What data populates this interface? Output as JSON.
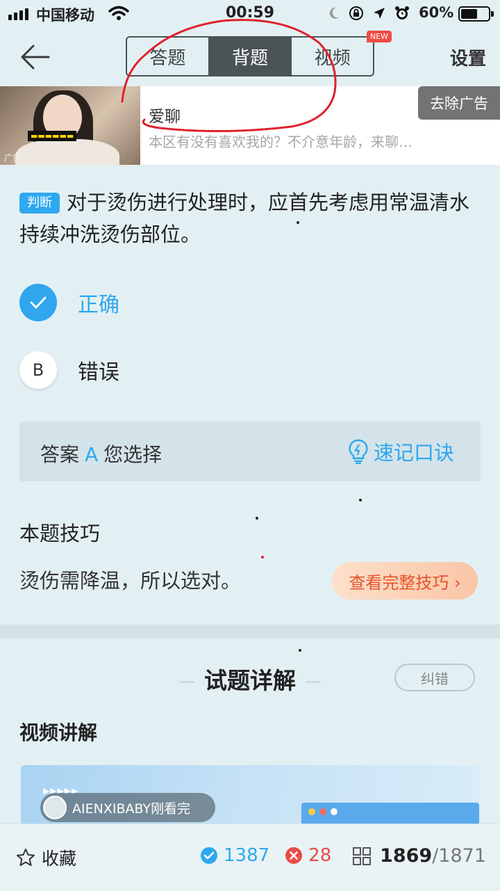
{
  "status_bar": {
    "carrier": "中国移动",
    "time": "00:59",
    "battery_pct": "60%",
    "battery_level": 0.6
  },
  "nav": {
    "tabs": [
      {
        "label": "答题",
        "active": false
      },
      {
        "label": "背题",
        "active": true
      },
      {
        "label": "视频",
        "active": false
      }
    ],
    "new_badge": "NEW",
    "settings": "设置"
  },
  "ad": {
    "title": "爱聊",
    "description": "本区有没有喜欢我的？不介意年龄，来聊…",
    "thumb_label": "广告",
    "remove_label": "去除广告"
  },
  "question": {
    "type_label": "判断",
    "text": "对于烫伤进行处理时，应首先考虑用常温清水持续冲洗烫伤部位。"
  },
  "options": [
    {
      "key": "A",
      "label": "正确",
      "selected": true
    },
    {
      "key": "B",
      "label": "错误",
      "selected": false
    }
  ],
  "answer_bar": {
    "answer_label": "答案",
    "answer_value": "A",
    "your_choice_label": "您选择",
    "mnemonic_label": "速记口诀"
  },
  "tip": {
    "heading": "本题技巧",
    "text": "烫伤需降温，所以选对。",
    "button_label": "查看完整技巧 ›"
  },
  "detail": {
    "title": "试题详解",
    "report_error": "纠错",
    "video_heading": "视频讲解",
    "viewer_text": "AIENXIBABY刚看完"
  },
  "bottom_bar": {
    "favorite_label": "收藏",
    "correct_count": "1387",
    "wrong_count": "28",
    "current": "1869",
    "total": "/1871"
  },
  "colors": {
    "accent": "#2ea8ef",
    "error": "#ea4b47",
    "background": "#e3f0f3",
    "annotation": "#e0212c"
  }
}
